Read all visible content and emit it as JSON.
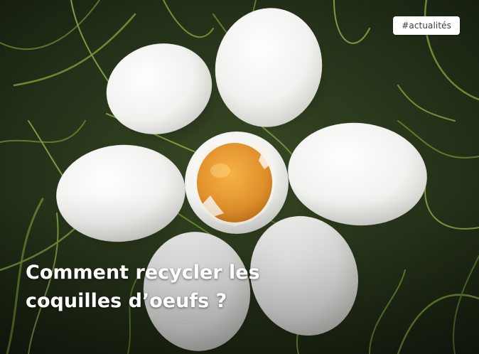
{
  "card": {
    "tag": "#actualités",
    "title_line1": "Comment recycler les",
    "title_line2": "coquilles d’oeufs ?"
  },
  "image": {
    "subject": "eggs-on-grass-photo",
    "colors": {
      "grass_dark": "#1f2a16",
      "grass_light": "#6f8f3a",
      "shell": "#f3f3f1",
      "yolk": "#e39a2b"
    }
  }
}
